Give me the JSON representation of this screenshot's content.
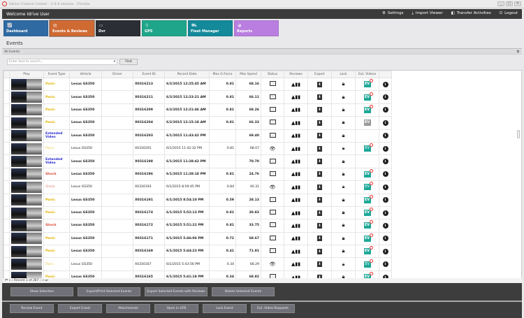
{
  "window": {
    "title": "Idrive Control Center - 3.4.4 version - Florida"
  },
  "header": {
    "welcome": "Welcome Idrive User",
    "nav": [
      {
        "label": "Settings",
        "icon": "gears-icon"
      },
      {
        "label": "Import Viewer",
        "icon": "download-icon"
      },
      {
        "label": "Transfer Activities",
        "icon": "transfer-icon"
      },
      {
        "label": "Logout",
        "icon": "power-icon"
      }
    ]
  },
  "tiles": [
    {
      "label": "Dashboard",
      "color": "#2f6aa3"
    },
    {
      "label": "Events & Reviews",
      "color": "#d06a33"
    },
    {
      "label": "Dvr",
      "color": "#2b2f35"
    },
    {
      "label": "GPS",
      "color": "#1fa68a"
    },
    {
      "label": "Fleet Manager",
      "color": "#13899a"
    },
    {
      "label": "Reports",
      "color": "#b97ee0"
    }
  ],
  "page": {
    "title": "Events",
    "group": "All Events",
    "search_placeholder": "Enter text to search...",
    "find": "Find"
  },
  "columns": [
    "Play",
    "Event Type",
    "Vehicle",
    "Driver",
    "Event ID",
    "Record Date",
    "Max G-Force",
    "Max Speed",
    "Status",
    "Reviews",
    "Export",
    "Lock",
    "Ext. Videos",
    ""
  ],
  "event_colors": {
    "Panic": "#e0b400",
    "Extended Video": "#2a2ad0",
    "Shock": "#d84a3a"
  },
  "rows": [
    {
      "type": "Panic",
      "vehicle": "Lexus GS350",
      "driver": "",
      "id": "X0316213",
      "date": "6/2/2015 12:25:45 AM",
      "g": "0.81",
      "speed": "68.16",
      "status": "image",
      "ev": "active",
      "bold": true
    },
    {
      "type": "Panic",
      "vehicle": "Lexus GS350",
      "driver": "",
      "id": "X0316211",
      "date": "6/2/2015 12:23:21 AM",
      "g": "0.81",
      "speed": "66.11",
      "status": "image",
      "ev": "active",
      "bold": true
    },
    {
      "type": "Panic",
      "vehicle": "Lexus GS350",
      "driver": "",
      "id": "X0316209",
      "date": "6/2/2015 12:21:46 AM",
      "g": "0.81",
      "speed": "68.26",
      "status": "image",
      "ev": "active",
      "bold": true
    },
    {
      "type": "Panic",
      "vehicle": "Lexus GS350",
      "driver": "",
      "id": "X0316204",
      "date": "6/2/2015 12:15:18 AM",
      "g": "0.81",
      "speed": "66.33",
      "status": "image",
      "ev": "gray",
      "bold": true
    },
    {
      "type": "Extended Video",
      "vehicle": "Lexus GS350",
      "driver": "",
      "id": "X0316203",
      "date": "6/1/2015 11:43:42 PM",
      "g": "",
      "speed": "69.40",
      "status": "image",
      "ev": "none",
      "bold": true
    },
    {
      "type": "Panic",
      "vehicle": "Lexus GS350",
      "driver": "",
      "id": "X0316201",
      "date": "6/1/2015 11:42:32 PM",
      "g": "0.81",
      "speed": "68.07",
      "status": "viewed",
      "ev": "active",
      "bold": false
    },
    {
      "type": "Extended Video",
      "vehicle": "Lexus GS350",
      "driver": "",
      "id": "X0316198",
      "date": "6/1/2015 11:28:42 PM",
      "g": "",
      "speed": "70.70",
      "status": "image",
      "ev": "none",
      "bold": true
    },
    {
      "type": "Shock",
      "vehicle": "Lexus GS350",
      "driver": "",
      "id": "X0316196",
      "date": "6/1/2015 11:28:18 PM",
      "g": "0.81",
      "speed": "24.76",
      "status": "image",
      "ev": "active",
      "bold": true
    },
    {
      "type": "Shock",
      "vehicle": "Lexus GS350",
      "driver": "",
      "id": "X0316193",
      "date": "6/1/2015 8:59:45 PM",
      "g": "0.84",
      "speed": "40.31",
      "status": "viewed",
      "ev": "active",
      "bold": false
    },
    {
      "type": "Panic",
      "vehicle": "Lexus GS350",
      "driver": "",
      "id": "X0316191",
      "date": "6/1/2015 8:54:10 PM",
      "g": "0.59",
      "speed": "28.13",
      "status": "image",
      "ev": "active",
      "bold": true
    },
    {
      "type": "Panic",
      "vehicle": "Lexus GS350",
      "driver": "",
      "id": "X0316174",
      "date": "6/1/2015 5:52:13 PM",
      "g": "0.81",
      "speed": "30.83",
      "status": "image",
      "ev": "active",
      "bold": true
    },
    {
      "type": "Shock",
      "vehicle": "Lexus GS350",
      "driver": "",
      "id": "X0316172",
      "date": "6/1/2015 5:51:22 PM",
      "g": "0.81",
      "speed": "33.75",
      "status": "image",
      "ev": "active",
      "bold": true
    },
    {
      "type": "Panic",
      "vehicle": "Lexus GS350",
      "driver": "",
      "id": "X0316171",
      "date": "6/1/2015 5:46:06 PM",
      "g": "0.72",
      "speed": "68.67",
      "status": "image",
      "ev": "active",
      "bold": true
    },
    {
      "type": "Panic",
      "vehicle": "Lexus GS350",
      "driver": "",
      "id": "X0316169",
      "date": "6/1/2015 5:44:23 PM",
      "g": "0.41",
      "speed": "71.91",
      "status": "image",
      "ev": "active",
      "bold": true
    },
    {
      "type": "Panic",
      "vehicle": "Lexus GS350",
      "driver": "",
      "id": "X0316167",
      "date": "6/1/2015 5:43:56 PM",
      "g": "0.34",
      "speed": "68.29",
      "status": "viewed",
      "ev": "active",
      "bold": false
    },
    {
      "type": "Panic",
      "vehicle": "Lexus GS350",
      "driver": "",
      "id": "X0316165",
      "date": "6/1/2015 5:41:18 PM",
      "g": "0.34",
      "speed": "68.82",
      "status": "image",
      "ev": "active",
      "bold": true
    }
  ],
  "pager": {
    "text": "Record 1 of 287"
  },
  "actions_top": [
    "Show Selection",
    "Export/Print Selected Events",
    "Export Selected Events with Reviews",
    "Delete Selected  Events"
  ],
  "actions_bottom": [
    "Review Event",
    "Export Event",
    "Attachments",
    "Open in GPS",
    "Lock Event",
    "Ext. Video Requests"
  ]
}
